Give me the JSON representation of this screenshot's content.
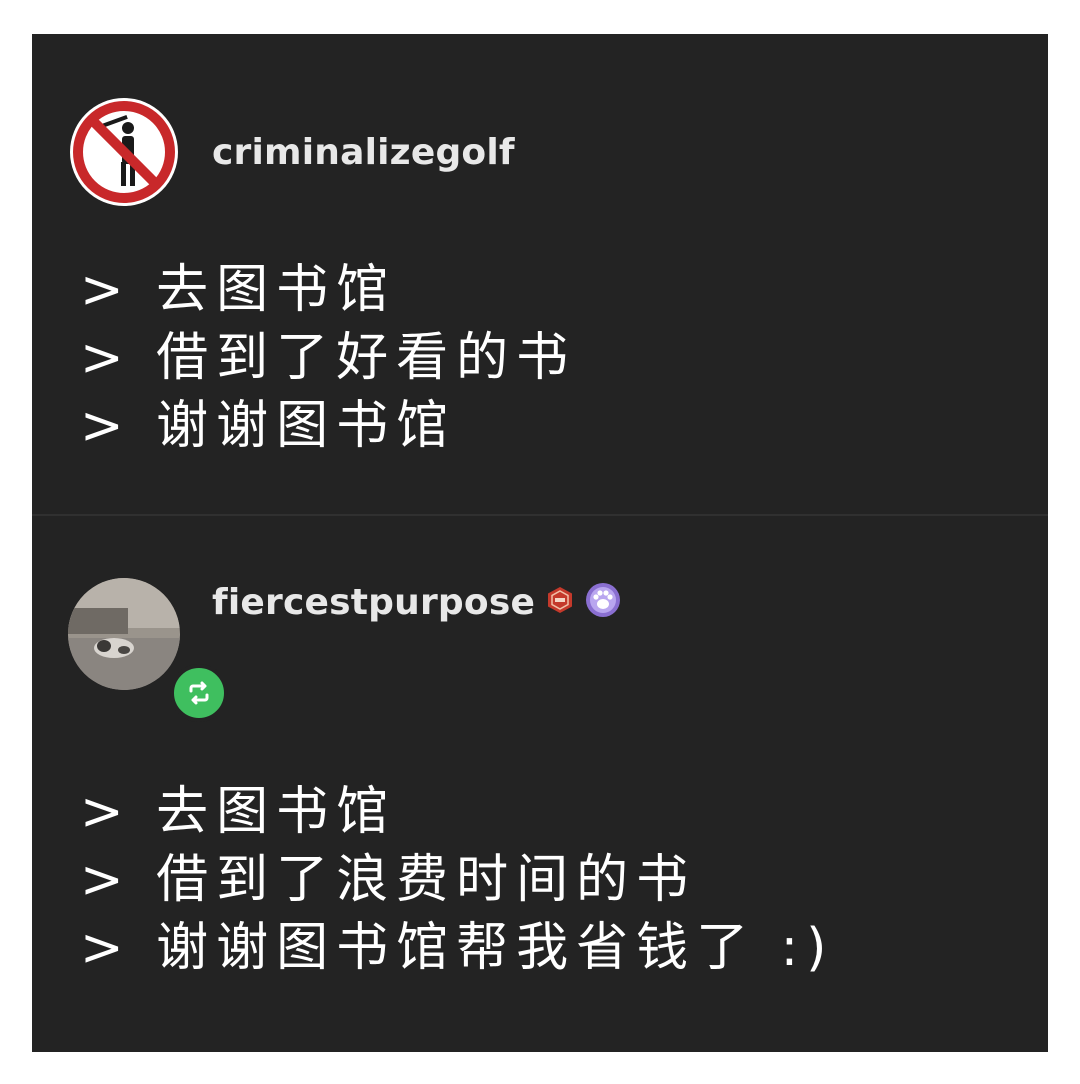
{
  "posts": [
    {
      "username": "criminalizegolf",
      "avatar_icon": "no-golf-sign-icon",
      "lines": [
        "> 去图书馆",
        "> 借到了好看的书",
        "> 谢谢图书馆"
      ]
    },
    {
      "username": "fiercestpurpose",
      "avatar_icon": "cat-photo-avatar",
      "reblog_icon": "reblog-icon",
      "badges": [
        "red-hexagon-badge-icon",
        "purple-paw-badge-icon"
      ],
      "lines": [
        "> 去图书馆",
        "> 借到了浪费时间的书",
        "> 谢谢图书馆帮我省钱了 :)"
      ]
    }
  ],
  "colors": {
    "background": "#232323",
    "text": "#ffffff",
    "reblog_green": "#3fbf5f",
    "no_sign_red": "#c8282a"
  }
}
